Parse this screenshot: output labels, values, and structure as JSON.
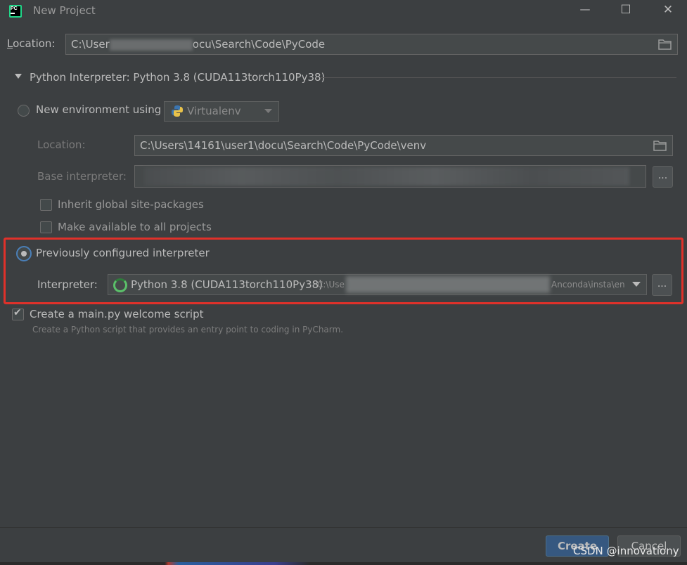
{
  "window": {
    "title": "New Project",
    "icon_text": "PC",
    "minimize_glyph": "—",
    "maximize_glyph": "☐",
    "close_glyph": "✕"
  },
  "location": {
    "label_first": "L",
    "label_rest": "ocation:",
    "value_start": "C:\\User",
    "value_end": "ocu\\Search\\Code\\PyCode"
  },
  "interpreter_section": {
    "title": "Python Interpreter: Python 3.8 (CUDA113torch110Py38)",
    "new_env": {
      "label": "New environment using",
      "env_type": "Virtualenv",
      "location_label": "Location:",
      "location_value": "C:\\Users\\14161\\user1\\docu\\Search\\Code\\PyCode\\venv",
      "base_interpreter_label": "Base interpreter:",
      "dots_label": "...",
      "inherit_label": "Inherit global site-packages",
      "make_available_label": "Make available to all projects"
    },
    "previous": {
      "label": "Previously configured interpreter",
      "interpreter_label": "Interpreter:",
      "interpreter_name": "Python 3.8 (CUDA113torch110Py38)",
      "path_start": "C:\\Use",
      "path_end": "Anconda\\insta\\en",
      "dots_label": "..."
    }
  },
  "welcome": {
    "label": "Create a main.py welcome script",
    "description": "Create a Python script that provides an entry point to coding in PyCharm.",
    "checked": true
  },
  "footer": {
    "create_label": "Create",
    "cancel_label": "Cancel",
    "watermark": "CSDN @innovationy"
  },
  "colors": {
    "background": "#3c3f41",
    "highlight": "#e0312a",
    "primary_button": "#365880"
  }
}
